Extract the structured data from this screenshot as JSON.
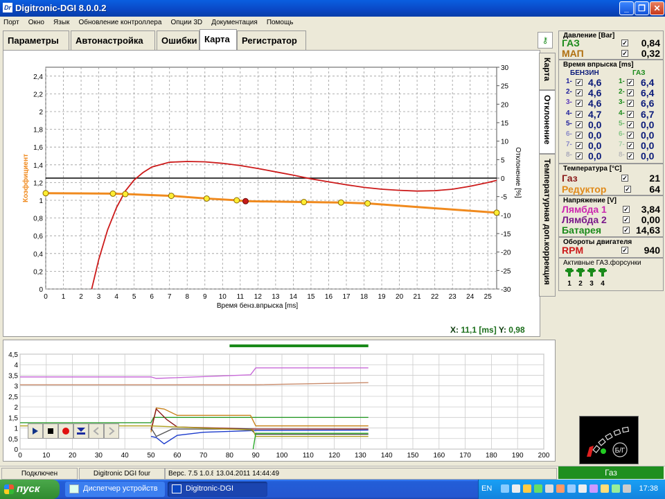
{
  "window": {
    "title": "Digitronic-DGI  8.0.0.2",
    "icon_text": "Dr"
  },
  "menu": [
    "Порт",
    "Окно",
    "Язык",
    "Обновление контроллера",
    "Опции 3D",
    "Документация",
    "Помощь"
  ],
  "tabs": [
    "Параметры",
    "Автонастройка",
    "Ошибки",
    "Карта",
    "Регистратор"
  ],
  "active_tab": "Карта",
  "side_tabs": [
    "Карта",
    "Отклонение",
    "Температурная доп.коррекция"
  ],
  "chart_data": {
    "type": "line",
    "xlabel": "Время бенз.впрыска [ms]",
    "ylabel": "Коэффициент",
    "y2label": "Отклонение [%]",
    "xlim": [
      0,
      25.5
    ],
    "xticks": [
      0,
      1,
      2,
      3,
      4,
      5,
      6,
      7,
      8,
      9,
      10,
      11,
      12,
      13,
      14,
      15,
      16,
      17,
      18,
      19,
      20,
      21,
      22,
      23,
      24,
      25
    ],
    "ylim": [
      0,
      2.5
    ],
    "yticks": [
      "0",
      "0,2",
      "0,4",
      "0,6",
      "0,8",
      "1",
      "1,2",
      "1,4",
      "1,6",
      "1,8",
      "2",
      "2,2",
      "2,4"
    ],
    "y2lim": [
      -30,
      30
    ],
    "y2ticks": [
      30,
      25,
      20,
      15,
      10,
      5,
      0,
      -5,
      -10,
      -15,
      -20,
      -25,
      -30
    ],
    "reference_line_y2": 0,
    "series": [
      {
        "name": "Коэффициент",
        "color": "#f08a1e",
        "x": [
          0,
          3.8,
          4.5,
          7.1,
          9.1,
          10.8,
          11.3,
          14.6,
          16.7,
          18.2,
          25.5
        ],
        "y": [
          1.08,
          1.075,
          1.07,
          1.05,
          1.02,
          1.0,
          0.99,
          0.98,
          0.975,
          0.965,
          0.86
        ],
        "markers_x": [
          0,
          3.8,
          4.5,
          7.1,
          9.1,
          10.8,
          14.6,
          16.7,
          18.2,
          25.5
        ],
        "selected_x": 11.3
      },
      {
        "name": "Отклонение",
        "color": "#cc1a1a",
        "x": [
          2.6,
          3.0,
          3.5,
          4.0,
          4.5,
          5.0,
          5.5,
          6.0,
          7.0,
          8.0,
          9.0,
          10.0,
          11.0,
          12.0,
          13.0,
          14.0,
          15.0,
          16.0,
          17.0,
          18.0,
          19.0,
          20.0,
          21.0,
          22.0,
          23.0,
          24.0,
          25.0,
          25.5
        ],
        "y": [
          -30,
          -22,
          -14,
          -8,
          -3.5,
          -0.5,
          1.5,
          3.0,
          4.3,
          4.5,
          4.4,
          4.0,
          3.4,
          2.6,
          1.7,
          0.8,
          -0.2,
          -1.0,
          -1.8,
          -2.5,
          -3.0,
          -3.3,
          -3.5,
          -3.4,
          -3.0,
          -2.2,
          -1.2,
          -0.6
        ]
      }
    ]
  },
  "readout": {
    "x_label": "X:",
    "x_value": "11,1 [ms]",
    "y_label": "Y:",
    "y_value": "0,98"
  },
  "recorder": {
    "xlim": [
      0,
      200
    ],
    "xticks": [
      0,
      10,
      20,
      30,
      40,
      50,
      60,
      70,
      80,
      90,
      100,
      110,
      120,
      130,
      140,
      150,
      160,
      170,
      180,
      190,
      200
    ],
    "ylim": [
      0,
      4.5
    ],
    "yticks": [
      "0",
      "0,5",
      "1",
      "1,5",
      "2",
      "2,5",
      "3",
      "3,5",
      "4",
      "4,5"
    ],
    "series": [
      {
        "color": "#c86ad8",
        "x": [
          0,
          50,
          52,
          88,
          90,
          133
        ],
        "y": [
          3.42,
          3.42,
          3.35,
          3.52,
          3.85,
          3.85
        ]
      },
      {
        "color": "#c88a6a",
        "x": [
          0,
          90,
          133
        ],
        "y": [
          3.05,
          3.05,
          3.15
        ]
      },
      {
        "color": "#2a9a2a",
        "x": [
          0,
          50,
          51,
          88,
          89,
          133
        ],
        "y": [
          1.25,
          1.25,
          1.5,
          1.5,
          1.5,
          1.5
        ]
      },
      {
        "color": "#c8821a",
        "x": [
          50,
          52,
          55,
          60,
          70,
          88,
          90,
          133
        ],
        "y": [
          0.8,
          1.95,
          1.9,
          1.6,
          1.6,
          1.6,
          1.1,
          1.1
        ]
      },
      {
        "color": "#8a1a1a",
        "x": [
          50,
          52,
          56,
          60,
          90,
          133
        ],
        "y": [
          0.9,
          1.9,
          1.4,
          1.05,
          0.95,
          0.95
        ]
      },
      {
        "color": "#1a3acc",
        "x": [
          50,
          52,
          55,
          60,
          70,
          90,
          133
        ],
        "y": [
          0.6,
          0.55,
          0.25,
          0.65,
          0.8,
          0.88,
          0.9
        ]
      },
      {
        "color": "#555555",
        "x": [
          50,
          52,
          58,
          88,
          90,
          133
        ],
        "y": [
          1.0,
          0.6,
          0.95,
          0.95,
          0.7,
          0.7
        ]
      },
      {
        "color": "#b0a020",
        "x": [
          0,
          50,
          89,
          90,
          133
        ],
        "y": [
          1.1,
          1.1,
          0.9,
          0.6,
          0.6
        ]
      },
      {
        "color": "#2aaa2a",
        "x": [
          89,
          90,
          133
        ],
        "y": [
          0,
          0.75,
          0.75
        ]
      }
    ],
    "highlight_range": [
      80,
      133
    ]
  },
  "player_buttons": [
    "play-icon",
    "stop-icon",
    "record-icon",
    "save-icon",
    "prev-icon",
    "next-icon"
  ],
  "pressure": {
    "title": "Давление [Bar]",
    "gas_label": "ГАЗ",
    "gas_value": "0,84",
    "map_label": "МАП",
    "map_value": "0,32"
  },
  "injection": {
    "title": "Время впрыска [ms]",
    "petrol_label": "БЕНЗИН",
    "gas_label": "ГАЗ",
    "rows": [
      {
        "n": "1-",
        "petrol": "4,6",
        "gas": "6,4"
      },
      {
        "n": "2-",
        "petrol": "4,6",
        "gas": "6,4"
      },
      {
        "n": "3-",
        "petrol": "4,6",
        "gas": "6,6"
      },
      {
        "n": "4-",
        "petrol": "4,7",
        "gas": "6,7"
      },
      {
        "n": "5-",
        "petrol": "0,0",
        "gas": "0,0"
      },
      {
        "n": "6-",
        "petrol": "0,0",
        "gas": "0,0"
      },
      {
        "n": "7-",
        "petrol": "0,0",
        "gas": "0,0"
      },
      {
        "n": "8-",
        "petrol": "0,0",
        "gas": "0,0"
      }
    ]
  },
  "temperature": {
    "title": "Температура [°C]",
    "gas_label": "Газ",
    "gas_value": "21",
    "reducer_label": "Редуктор",
    "reducer_value": "64"
  },
  "voltage": {
    "title": "Напряжение [V]",
    "lambda1_label": "Лямбда 1",
    "lambda1_value": "3,84",
    "lambda2_label": "Лямбда 2",
    "lambda2_value": "0,00",
    "battery_label": "Батарея",
    "battery_value": "14,63"
  },
  "rpm": {
    "title": "Обороты двигателя",
    "label": "RPM",
    "value": "940"
  },
  "active_injectors": {
    "title": "Активные ГАЗ.форсунки",
    "numbers": [
      "1",
      "2",
      "3",
      "4"
    ]
  },
  "indicator": {
    "label": "Б/Г"
  },
  "status": {
    "connection": "Подключен",
    "device": "Digitronic DGI four",
    "version": "Верс. 7.5  1.0.8",
    "datetime": "13.04.2011 14:44:49",
    "gas": "Газ"
  },
  "taskbar": {
    "start": "пуск",
    "tasks": [
      "Диспетчер устройств",
      "Digitronic-DGI"
    ],
    "lang": "EN",
    "clock": "17:38"
  },
  "colors": {
    "titlebar": "#0a47c4",
    "orange": "#f08a1e",
    "red": "#cc1a1a",
    "green_status": "#1f8f1f"
  }
}
